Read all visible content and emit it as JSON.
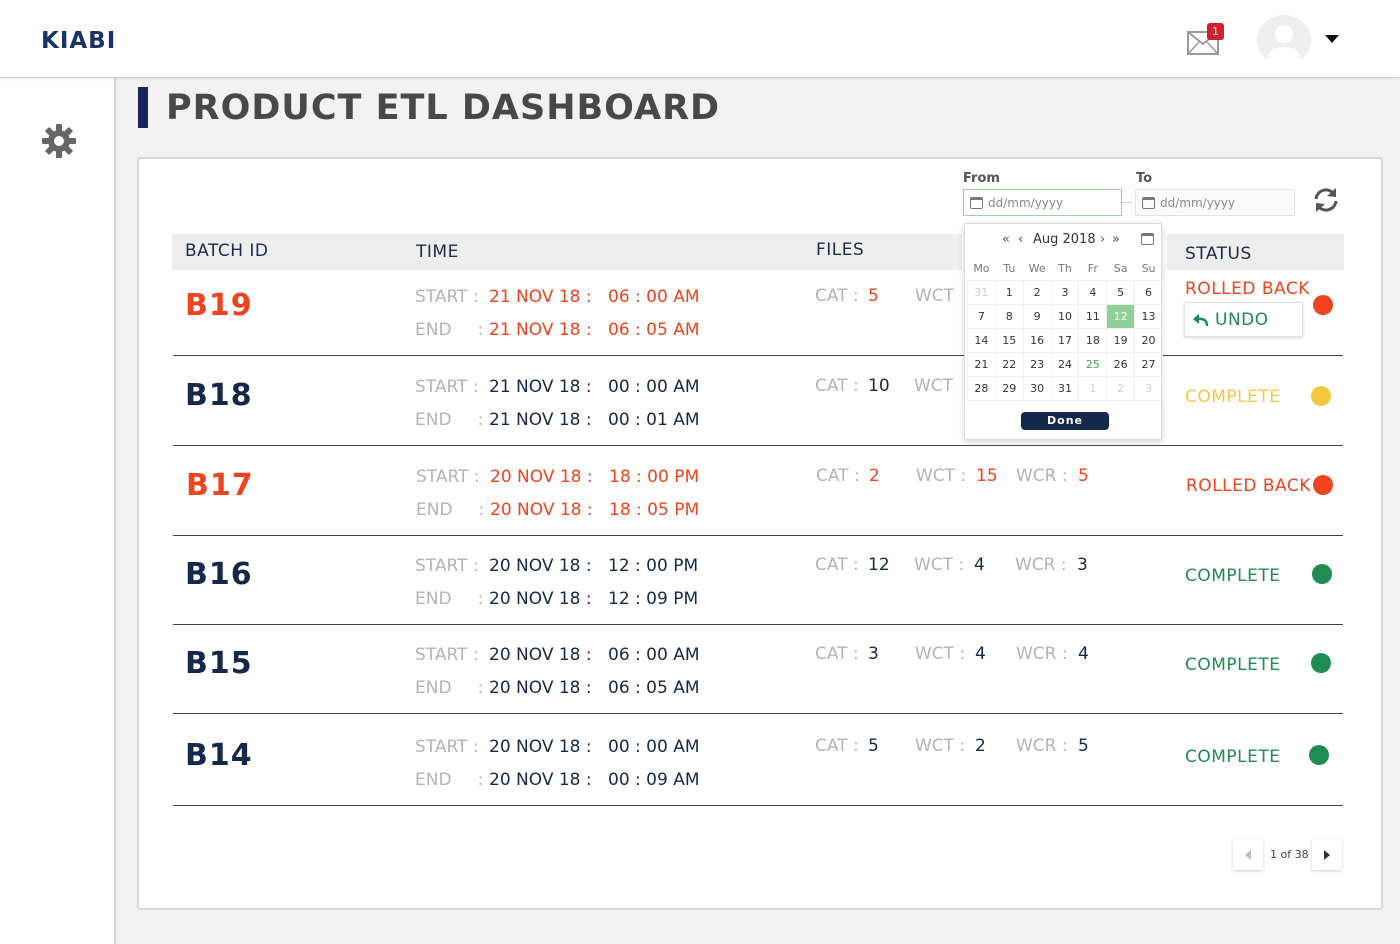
{
  "header": {
    "logo": "KIABI",
    "notifications_count": "1"
  },
  "page": {
    "title": "PRODUCT ETL DASHBOARD"
  },
  "filter": {
    "from_label": "From",
    "to_label": "To",
    "from_placeholder": "dd/mm/yyyy",
    "to_placeholder": "dd/mm/yyyy"
  },
  "calendar": {
    "month": "Aug 2018",
    "weekdays": [
      "Mo",
      "Tu",
      "We",
      "Th",
      "Fr",
      "Sa",
      "Su"
    ],
    "weeks": [
      [
        "31",
        "1",
        "2",
        "3",
        "4",
        "5",
        "6"
      ],
      [
        "7",
        "8",
        "9",
        "10",
        "11",
        "12",
        "13"
      ],
      [
        "14",
        "15",
        "16",
        "17",
        "18",
        "19",
        "20"
      ],
      [
        "21",
        "22",
        "23",
        "24",
        "25",
        "26",
        "27"
      ],
      [
        "28",
        "29",
        "30",
        "31",
        "1",
        "2",
        "3"
      ]
    ],
    "selected_day": "12",
    "today_day": "25",
    "done_label": "Done"
  },
  "table": {
    "headers": {
      "batch": "BATCH ID",
      "time": "TIME",
      "files": "FILES",
      "status": "STATUS"
    },
    "start_label": "START",
    "end_label": "END",
    "cat_label": "CAT",
    "wct_label": "WCT",
    "wcr_label": "WCR",
    "rows": [
      {
        "id": "B19",
        "start_date": "21 NOV 18 :",
        "start_time": "06 : 00 AM",
        "end_date": "21 NOV 18 :",
        "end_time": "06 : 05 AM",
        "cat": "5",
        "wct": "",
        "wcr": "",
        "status": "ROLLED BACK"
      },
      {
        "id": "B18",
        "start_date": "21 NOV 18 :",
        "start_time": "00 : 00 AM",
        "end_date": "21 NOV 18 :",
        "end_time": "00 : 01 AM",
        "cat": "10",
        "wct": "",
        "wcr": "",
        "status": "COMPLETE"
      },
      {
        "id": "B17",
        "start_date": "20 NOV 18 :",
        "start_time": "18 : 00 PM",
        "end_date": "20 NOV 18 :",
        "end_time": "18 : 05 PM",
        "cat": "2",
        "wct": "15",
        "wcr": "5",
        "status": "ROLLED BACK"
      },
      {
        "id": "B16",
        "start_date": "20 NOV 18 :",
        "start_time": "12 : 00 PM",
        "end_date": "20 NOV 18 :",
        "end_time": "12 : 09 PM",
        "cat": "12",
        "wct": "4",
        "wcr": "3",
        "status": "COMPLETE"
      },
      {
        "id": "B15",
        "start_date": "20 NOV 18 :",
        "start_time": "06 : 00 AM",
        "end_date": "20 NOV 18 :",
        "end_time": "06 : 05 AM",
        "cat": "3",
        "wct": "4",
        "wcr": "4",
        "status": "COMPLETE"
      },
      {
        "id": "B14",
        "start_date": "20 NOV 18 :",
        "start_time": "00 : 00 AM",
        "end_date": "20 NOV 18 :",
        "end_time": "00 : 09 AM",
        "cat": "5",
        "wct": "2",
        "wcr": "5",
        "status": "COMPLETE"
      }
    ],
    "undo_label": "UNDO"
  },
  "pagination": {
    "text": "1 of 38"
  },
  "colors": {
    "navy": "#14284b",
    "rolled_back": "#f0431e",
    "complete_green": "#1f8c54",
    "complete_yellow": "#f5c842",
    "calendar_selected": "#8fcf98"
  }
}
